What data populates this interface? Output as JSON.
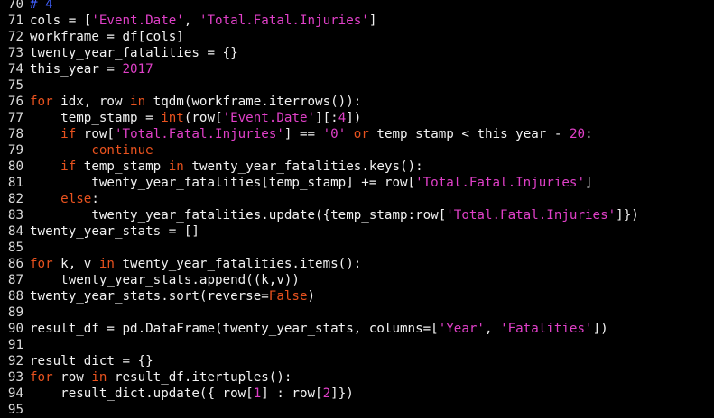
{
  "colors": {
    "background": "#000000",
    "text": "#f2f2f2",
    "line_number": "#dcdcdc",
    "keyword": "#e8521e",
    "string": "#e040c8",
    "number": "#e040c8",
    "comment": "#4060ff"
  },
  "lines": [
    {
      "n": "70",
      "tokens": [
        [
          "cm",
          "# 4"
        ]
      ]
    },
    {
      "n": "71",
      "tokens": [
        [
          "",
          "cols = ["
        ],
        [
          "str",
          "'Event.Date'"
        ],
        [
          "",
          ", "
        ],
        [
          "str",
          "'Total.Fatal.Injuries'"
        ],
        [
          "",
          "]"
        ]
      ]
    },
    {
      "n": "72",
      "tokens": [
        [
          "",
          "workframe = df[cols]"
        ]
      ]
    },
    {
      "n": "73",
      "tokens": [
        [
          "",
          "twenty_year_fatalities = {}"
        ]
      ]
    },
    {
      "n": "74",
      "tokens": [
        [
          "",
          "this_year = "
        ],
        [
          "num",
          "2017"
        ]
      ]
    },
    {
      "n": "75",
      "tokens": []
    },
    {
      "n": "76",
      "tokens": [
        [
          "kw",
          "for"
        ],
        [
          "",
          " idx, row "
        ],
        [
          "kw",
          "in"
        ],
        [
          "",
          " tqdm(workframe.iterrows()):"
        ]
      ]
    },
    {
      "n": "77",
      "tokens": [
        [
          "",
          "    temp_stamp = "
        ],
        [
          "kw",
          "int"
        ],
        [
          "",
          "(row["
        ],
        [
          "str",
          "'Event.Date'"
        ],
        [
          "",
          "][:"
        ],
        [
          "num",
          "4"
        ],
        [
          "",
          "])"
        ]
      ]
    },
    {
      "n": "78",
      "tokens": [
        [
          "",
          "    "
        ],
        [
          "kw",
          "if"
        ],
        [
          "",
          " row["
        ],
        [
          "str",
          "'Total.Fatal.Injuries'"
        ],
        [
          "",
          "] == "
        ],
        [
          "str",
          "'0'"
        ],
        [
          "",
          " "
        ],
        [
          "kw",
          "or"
        ],
        [
          "",
          " temp_stamp < this_year - "
        ],
        [
          "num",
          "20"
        ],
        [
          "",
          ":"
        ]
      ]
    },
    {
      "n": "79",
      "tokens": [
        [
          "",
          "        "
        ],
        [
          "kw",
          "continue"
        ]
      ]
    },
    {
      "n": "80",
      "tokens": [
        [
          "",
          "    "
        ],
        [
          "kw",
          "if"
        ],
        [
          "",
          " temp_stamp "
        ],
        [
          "kw",
          "in"
        ],
        [
          "",
          " twenty_year_fatalities.keys():"
        ]
      ]
    },
    {
      "n": "81",
      "tokens": [
        [
          "",
          "        twenty_year_fatalities[temp_stamp] += row["
        ],
        [
          "str",
          "'Total.Fatal.Injuries'"
        ],
        [
          "",
          "]"
        ]
      ]
    },
    {
      "n": "82",
      "tokens": [
        [
          "",
          "    "
        ],
        [
          "kw",
          "else"
        ],
        [
          "",
          ":"
        ]
      ]
    },
    {
      "n": "83",
      "tokens": [
        [
          "",
          "        twenty_year_fatalities.update({temp_stamp:row["
        ],
        [
          "str",
          "'Total.Fatal.Injuries'"
        ],
        [
          "",
          "]})"
        ]
      ]
    },
    {
      "n": "84",
      "tokens": [
        [
          "",
          "twenty_year_stats = []"
        ]
      ]
    },
    {
      "n": "85",
      "tokens": []
    },
    {
      "n": "86",
      "tokens": [
        [
          "kw",
          "for"
        ],
        [
          "",
          " k, v "
        ],
        [
          "kw",
          "in"
        ],
        [
          "",
          " twenty_year_fatalities.items():"
        ]
      ]
    },
    {
      "n": "87",
      "tokens": [
        [
          "",
          "    twenty_year_stats.append((k,v))"
        ]
      ]
    },
    {
      "n": "88",
      "tokens": [
        [
          "",
          "twenty_year_stats.sort(reverse="
        ],
        [
          "kw",
          "False"
        ],
        [
          "",
          ")"
        ]
      ]
    },
    {
      "n": "89",
      "tokens": []
    },
    {
      "n": "90",
      "tokens": [
        [
          "",
          "result_df = pd.DataFrame(twenty_year_stats, columns=["
        ],
        [
          "str",
          "'Year'"
        ],
        [
          "",
          ", "
        ],
        [
          "str",
          "'Fatalities'"
        ],
        [
          "",
          "])"
        ]
      ]
    },
    {
      "n": "91",
      "tokens": []
    },
    {
      "n": "92",
      "tokens": [
        [
          "",
          "result_dict = {}"
        ]
      ]
    },
    {
      "n": "93",
      "tokens": [
        [
          "kw",
          "for"
        ],
        [
          "",
          " row "
        ],
        [
          "kw",
          "in"
        ],
        [
          "",
          " result_df.itertuples():"
        ]
      ]
    },
    {
      "n": "94",
      "tokens": [
        [
          "",
          "    result_dict.update({ row["
        ],
        [
          "num",
          "1"
        ],
        [
          "",
          "] : row["
        ],
        [
          "num",
          "2"
        ],
        [
          "",
          "]})"
        ]
      ]
    },
    {
      "n": "95",
      "tokens": []
    }
  ]
}
